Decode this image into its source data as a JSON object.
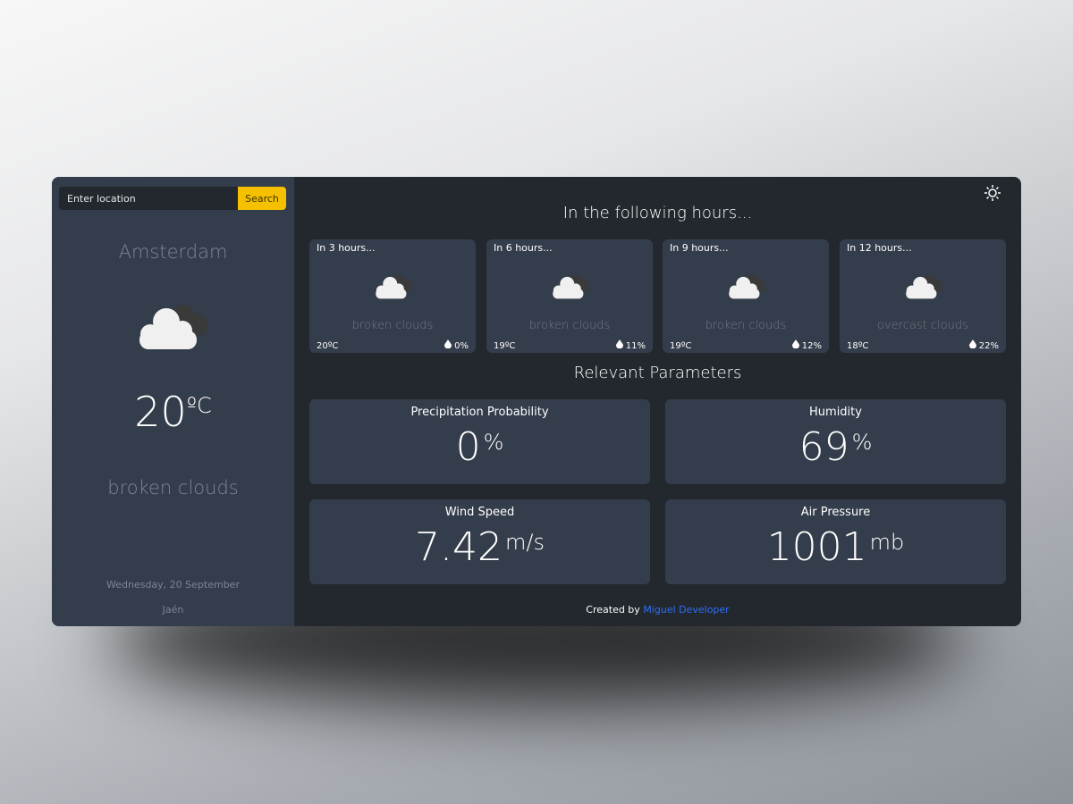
{
  "search": {
    "placeholder": "Enter location",
    "button": "Search"
  },
  "current": {
    "city": "Amsterdam",
    "temp": "20",
    "unit": "ºC",
    "description": "broken clouds",
    "date": "Wednesday, 20 September",
    "location": "Jaén",
    "icon": "broken-clouds-icon"
  },
  "forecast": {
    "title": "In the following hours...",
    "items": [
      {
        "label": "In 3 hours...",
        "description": "broken clouds",
        "temp": "20ºC",
        "precip": "0%"
      },
      {
        "label": "In 6 hours...",
        "description": "broken clouds",
        "temp": "19ºC",
        "precip": "11%"
      },
      {
        "label": "In 9 hours...",
        "description": "broken clouds",
        "temp": "19ºC",
        "precip": "12%"
      },
      {
        "label": "In 12 hours...",
        "description": "overcast clouds",
        "temp": "18ºC",
        "precip": "22%"
      }
    ]
  },
  "params": {
    "title": "Relevant Parameters",
    "items": [
      {
        "label": "Precipitation Probability",
        "value": "0",
        "unit": "%"
      },
      {
        "label": "Humidity",
        "value": "69",
        "unit": "%"
      },
      {
        "label": "Wind Speed",
        "value": "7.42",
        "unit": "m/s"
      },
      {
        "label": "Air Pressure",
        "value": "1001",
        "unit": "mb"
      }
    ]
  },
  "footer": {
    "prefix": "Created by",
    "author": "Miguel Developer"
  },
  "colors": {
    "accent": "#f5c000",
    "link": "#2d6ef5",
    "panel": "#343d4b",
    "bg": "#23282f"
  }
}
